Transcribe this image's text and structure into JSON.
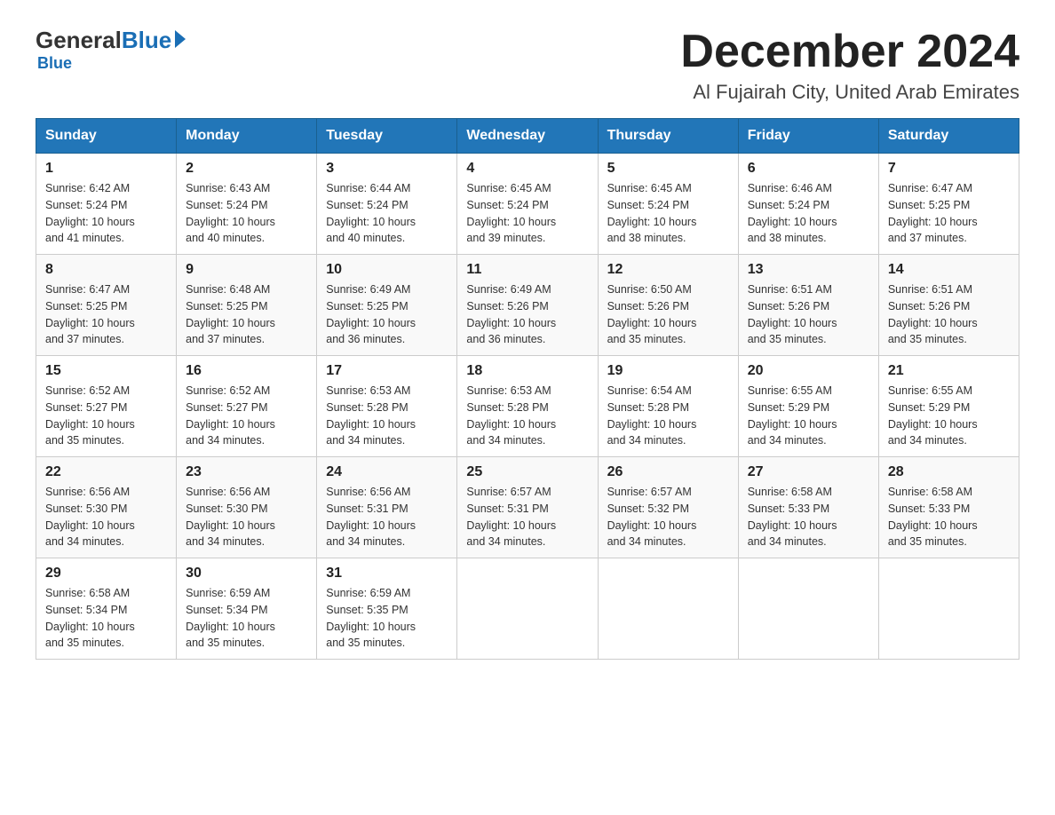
{
  "logo": {
    "general": "General",
    "blue": "Blue",
    "subtitle": "Blue"
  },
  "header": {
    "month_title": "December 2024",
    "location": "Al Fujairah City, United Arab Emirates"
  },
  "days_of_week": [
    "Sunday",
    "Monday",
    "Tuesday",
    "Wednesday",
    "Thursday",
    "Friday",
    "Saturday"
  ],
  "weeks": [
    [
      {
        "day": "1",
        "sunrise": "6:42 AM",
        "sunset": "5:24 PM",
        "daylight": "10 hours and 41 minutes."
      },
      {
        "day": "2",
        "sunrise": "6:43 AM",
        "sunset": "5:24 PM",
        "daylight": "10 hours and 40 minutes."
      },
      {
        "day": "3",
        "sunrise": "6:44 AM",
        "sunset": "5:24 PM",
        "daylight": "10 hours and 40 minutes."
      },
      {
        "day": "4",
        "sunrise": "6:45 AM",
        "sunset": "5:24 PM",
        "daylight": "10 hours and 39 minutes."
      },
      {
        "day": "5",
        "sunrise": "6:45 AM",
        "sunset": "5:24 PM",
        "daylight": "10 hours and 38 minutes."
      },
      {
        "day": "6",
        "sunrise": "6:46 AM",
        "sunset": "5:24 PM",
        "daylight": "10 hours and 38 minutes."
      },
      {
        "day": "7",
        "sunrise": "6:47 AM",
        "sunset": "5:25 PM",
        "daylight": "10 hours and 37 minutes."
      }
    ],
    [
      {
        "day": "8",
        "sunrise": "6:47 AM",
        "sunset": "5:25 PM",
        "daylight": "10 hours and 37 minutes."
      },
      {
        "day": "9",
        "sunrise": "6:48 AM",
        "sunset": "5:25 PM",
        "daylight": "10 hours and 37 minutes."
      },
      {
        "day": "10",
        "sunrise": "6:49 AM",
        "sunset": "5:25 PM",
        "daylight": "10 hours and 36 minutes."
      },
      {
        "day": "11",
        "sunrise": "6:49 AM",
        "sunset": "5:26 PM",
        "daylight": "10 hours and 36 minutes."
      },
      {
        "day": "12",
        "sunrise": "6:50 AM",
        "sunset": "5:26 PM",
        "daylight": "10 hours and 35 minutes."
      },
      {
        "day": "13",
        "sunrise": "6:51 AM",
        "sunset": "5:26 PM",
        "daylight": "10 hours and 35 minutes."
      },
      {
        "day": "14",
        "sunrise": "6:51 AM",
        "sunset": "5:26 PM",
        "daylight": "10 hours and 35 minutes."
      }
    ],
    [
      {
        "day": "15",
        "sunrise": "6:52 AM",
        "sunset": "5:27 PM",
        "daylight": "10 hours and 35 minutes."
      },
      {
        "day": "16",
        "sunrise": "6:52 AM",
        "sunset": "5:27 PM",
        "daylight": "10 hours and 34 minutes."
      },
      {
        "day": "17",
        "sunrise": "6:53 AM",
        "sunset": "5:28 PM",
        "daylight": "10 hours and 34 minutes."
      },
      {
        "day": "18",
        "sunrise": "6:53 AM",
        "sunset": "5:28 PM",
        "daylight": "10 hours and 34 minutes."
      },
      {
        "day": "19",
        "sunrise": "6:54 AM",
        "sunset": "5:28 PM",
        "daylight": "10 hours and 34 minutes."
      },
      {
        "day": "20",
        "sunrise": "6:55 AM",
        "sunset": "5:29 PM",
        "daylight": "10 hours and 34 minutes."
      },
      {
        "day": "21",
        "sunrise": "6:55 AM",
        "sunset": "5:29 PM",
        "daylight": "10 hours and 34 minutes."
      }
    ],
    [
      {
        "day": "22",
        "sunrise": "6:56 AM",
        "sunset": "5:30 PM",
        "daylight": "10 hours and 34 minutes."
      },
      {
        "day": "23",
        "sunrise": "6:56 AM",
        "sunset": "5:30 PM",
        "daylight": "10 hours and 34 minutes."
      },
      {
        "day": "24",
        "sunrise": "6:56 AM",
        "sunset": "5:31 PM",
        "daylight": "10 hours and 34 minutes."
      },
      {
        "day": "25",
        "sunrise": "6:57 AM",
        "sunset": "5:31 PM",
        "daylight": "10 hours and 34 minutes."
      },
      {
        "day": "26",
        "sunrise": "6:57 AM",
        "sunset": "5:32 PM",
        "daylight": "10 hours and 34 minutes."
      },
      {
        "day": "27",
        "sunrise": "6:58 AM",
        "sunset": "5:33 PM",
        "daylight": "10 hours and 34 minutes."
      },
      {
        "day": "28",
        "sunrise": "6:58 AM",
        "sunset": "5:33 PM",
        "daylight": "10 hours and 35 minutes."
      }
    ],
    [
      {
        "day": "29",
        "sunrise": "6:58 AM",
        "sunset": "5:34 PM",
        "daylight": "10 hours and 35 minutes."
      },
      {
        "day": "30",
        "sunrise": "6:59 AM",
        "sunset": "5:34 PM",
        "daylight": "10 hours and 35 minutes."
      },
      {
        "day": "31",
        "sunrise": "6:59 AM",
        "sunset": "5:35 PM",
        "daylight": "10 hours and 35 minutes."
      },
      null,
      null,
      null,
      null
    ]
  ],
  "labels": {
    "sunrise_prefix": "Sunrise: ",
    "sunset_prefix": "Sunset: ",
    "daylight_prefix": "Daylight: "
  }
}
